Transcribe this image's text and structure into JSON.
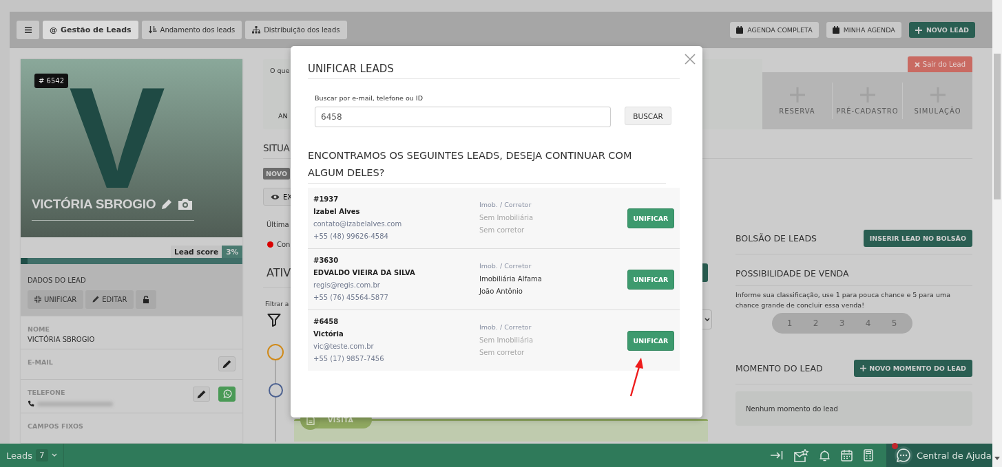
{
  "toolbar": {
    "tabs": [
      {
        "label": "Gestão de Leads",
        "glyph": "@",
        "selected": true
      },
      {
        "label": "Andamento dos leads",
        "kind": "sort",
        "selected": false
      },
      {
        "label": "Distribuição dos leads",
        "kind": "tree",
        "selected": false
      }
    ],
    "actions": [
      {
        "label": "AGENDA COMPLETA",
        "kind": "calendar"
      },
      {
        "label": "MINHA AGENDA",
        "kind": "calendar"
      },
      {
        "label": "NOVO LEAD",
        "kind": "primary"
      }
    ]
  },
  "lead_card": {
    "id_badge": "# 6542",
    "initial": "V",
    "name": "VICTÓRIA SBROGIO",
    "score_label": "Lead score",
    "score": "3%",
    "level": 0.03,
    "section_title": "DADOS DO LEAD",
    "buttons": [
      {
        "label": "UNIFICAR",
        "kind": "merge"
      },
      {
        "label": "EDITAR",
        "kind": "edit"
      },
      {
        "kind": "lock"
      }
    ],
    "fields": [
      {
        "label": "NOME",
        "value": "VICTÓRIA SBROGIO"
      },
      {
        "label": "E-MAIL",
        "editable": true
      },
      {
        "label": "TELEFONE",
        "editable": true,
        "whatsapp": true,
        "redacted": true
      },
      {
        "label": "CAMPOS FIXOS"
      }
    ]
  },
  "summary": {
    "text": "O que",
    "label": "AN",
    "exit_button": "Sair do Lead",
    "shortcuts": [
      "RESERVA",
      "PRÉ-CADASTRO",
      "SIMULAÇÃO"
    ]
  },
  "situation": {
    "heading": "SITUA",
    "status_badge": "NOVO",
    "view_button": "EX",
    "last_update": "Última",
    "status": "Con"
  },
  "activities": {
    "heading": "ATIV",
    "filter_label": "Filtrar a",
    "timeline": [
      {
        "color": "#d08a1a"
      },
      {
        "color": "#4c6190"
      }
    ],
    "visit_label": "VISITA"
  },
  "right_panel": {
    "pool": {
      "title": "BOLSÃO DE LEADS",
      "button": "INSERIR LEAD NO BOLSÃO"
    },
    "possibility": {
      "title": "POSSIBILIDADE DE VENDA",
      "hint": "Informe sua classificação, use 1 para pouca chance e 5 para uma chance grande de concluir essa venda!",
      "options": [
        {
          "label": "1",
          "selected": false
        },
        {
          "label": "2",
          "selected": false
        },
        {
          "label": "3",
          "selected": false
        },
        {
          "label": "4",
          "selected": false
        },
        {
          "label": "5",
          "selected": false
        }
      ]
    },
    "moment": {
      "title": "MOMENTO DO LEAD",
      "button": "NOVO MOMENTO DO LEAD",
      "empty": "Nenhum momento do lead"
    }
  },
  "modal": {
    "title": "UNIFICAR LEADS",
    "search_label": "Buscar por e-mail, telefone ou ID",
    "search_value": "6458",
    "search_button": "BUSCAR",
    "results_heading": "ENCONTRAMOS OS SEGUINTES LEADS, DESEJA CONTINUAR COM ALGUM DELES?",
    "results": [
      {
        "id": "#1937",
        "name": "Izabel Alves",
        "email": "contato@izabelalves.com",
        "phone": "+55 (48) 99626-4584",
        "agency_label": "Imob. / Corretor",
        "agency": "Sem Imobiliária",
        "broker": "Sem corretor",
        "assigned": false,
        "button": "UNIFICAR"
      },
      {
        "id": "#3630",
        "name": "EDVALDO VIEIRA DA SILVA",
        "email": "regis@regis.com.br",
        "phone": "+55 (76) 45564-5877",
        "agency_label": "Imob. / Corretor",
        "agency": "Imobiliária Alfama",
        "broker": "João Antônio",
        "assigned": true,
        "button": "UNIFICAR"
      },
      {
        "id": "#6458",
        "name": "Victória",
        "email": "vic@teste.com.br",
        "phone": "+55 (17) 9857-7456",
        "agency_label": "Imob. / Corretor",
        "agency": "Sem Imobiliária",
        "broker": "Sem corretor",
        "assigned": false,
        "button": "UNIFICAR"
      }
    ]
  },
  "bottom_bar": {
    "label": "Leads",
    "count": "7",
    "help": "Central de Ajuda",
    "help_notification": true
  }
}
